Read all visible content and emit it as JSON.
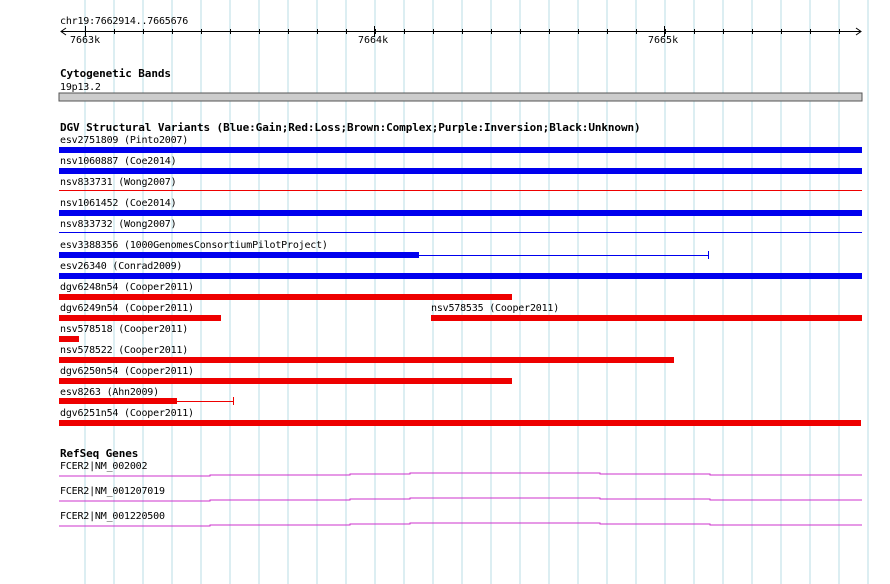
{
  "ruler": {
    "range_label": "chr19:7662914..7665676",
    "major_ticks": [
      "7663k",
      "7664k",
      "7665k"
    ]
  },
  "cytoband_track": {
    "title": "Cytogenetic Bands",
    "band_label": "19p13.2",
    "band_color": "#cccccc"
  },
  "dgv_track": {
    "title": "DGV Structural Variants (Blue:Gain;Red:Loss;Brown:Complex;Purple:Inversion;Black:Unknown)",
    "colors": {
      "gain": "#0000ee",
      "loss": "#ee0000"
    },
    "features": [
      {
        "label": "esv2751809 (Pinto2007)",
        "type": "gain"
      },
      {
        "label": "nsv1060887 (Coe2014)",
        "type": "gain"
      },
      {
        "label": "nsv833731 (Wong2007)",
        "type": "loss"
      },
      {
        "label": "nsv1061452 (Coe2014)",
        "type": "gain"
      },
      {
        "label": "nsv833732 (Wong2007)",
        "type": "gain"
      },
      {
        "label": "esv3388356 (1000GenomesConsortiumPilotProject)",
        "type": "gain"
      },
      {
        "label": "esv26340 (Conrad2009)",
        "type": "gain"
      },
      {
        "label": "dgv6248n54 (Cooper2011)",
        "type": "loss"
      },
      {
        "label": "dgv6249n54 (Cooper2011)",
        "type": "loss"
      },
      {
        "label": "nsv578535 (Cooper2011)",
        "type": "loss"
      },
      {
        "label": "nsv578518 (Cooper2011)",
        "type": "loss"
      },
      {
        "label": "nsv578522 (Cooper2011)",
        "type": "loss"
      },
      {
        "label": "dgv6250n54 (Cooper2011)",
        "type": "loss"
      },
      {
        "label": "esv8263 (Ahn2009)",
        "type": "loss"
      },
      {
        "label": "dgv6251n54 (Cooper2011)",
        "type": "loss"
      }
    ]
  },
  "refseq_track": {
    "title": "RefSeq Genes",
    "color": "#cc33cc",
    "transcripts": [
      {
        "label": "FCER2|NM_002002"
      },
      {
        "label": "FCER2|NM_001207019"
      },
      {
        "label": "FCER2|NM_001220500"
      }
    ]
  }
}
